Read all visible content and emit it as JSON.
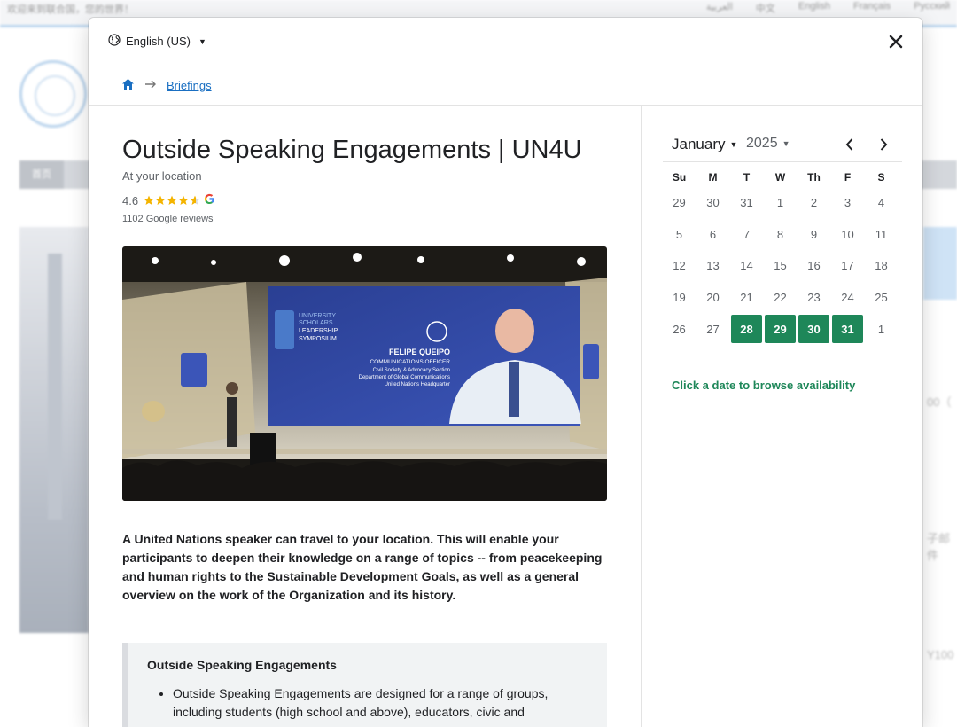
{
  "background": {
    "welcome_text": "欢迎来到联合国，您的世界！",
    "languages": [
      "العربية",
      "中文",
      "English",
      "Français",
      "Русский"
    ],
    "nav_first": "首页",
    "right_fragments": [
      "00（",
      "子邮件",
      "Y100"
    ]
  },
  "header": {
    "language_label": "English (US)",
    "breadcrumb": {
      "home_icon": "home-icon",
      "separator_icon": "arrow-right-icon",
      "current": "Briefings"
    },
    "close_icon": "close-icon"
  },
  "listing": {
    "title": "Outside Speaking Engagements | UN4U",
    "location": "At your location",
    "rating": "4.6",
    "stars": 4.6,
    "reviews": "1102 Google reviews",
    "hero": {
      "banner_line1": "UNIVERSITY",
      "banner_line2": "SCHOLARS",
      "banner_line3": "LEADERSHIP",
      "banner_line4": "SYMPOSIUM",
      "speaker_name": "FELIPE QUEIPO",
      "speaker_title": "COMMUNICATIONS OFFICER",
      "speaker_line3": "Civil Society & Advocacy Section",
      "speaker_line4": "Department of Global Communications",
      "speaker_line5": "United Nations Headquarter"
    },
    "description": "A United Nations speaker can travel to your location. This will enable your participants to deepen their knowledge on a range of topics -- from peacekeeping and human rights to the Sustainable Development Goals, as well as a general overview on the work of the Organization and its history.",
    "info_box": {
      "heading": "Outside Speaking Engagements",
      "bullet1": "Outside Speaking Engagements are designed for a range of groups, including students (high school and above), educators, civic and"
    }
  },
  "calendar": {
    "month": "January",
    "year": "2025",
    "weekdays": [
      "Su",
      "M",
      "T",
      "W",
      "Th",
      "F",
      "S"
    ],
    "weeks": [
      [
        "29",
        "30",
        "31",
        "1",
        "2",
        "3",
        "4"
      ],
      [
        "5",
        "6",
        "7",
        "8",
        "9",
        "10",
        "11"
      ],
      [
        "12",
        "13",
        "14",
        "15",
        "16",
        "17",
        "18"
      ],
      [
        "19",
        "20",
        "21",
        "22",
        "23",
        "24",
        "25"
      ],
      [
        "26",
        "27",
        "28",
        "29",
        "30",
        "31",
        "1"
      ]
    ],
    "available_color": "#1e8759",
    "hint": "Click a date to browse availability"
  },
  "colors": {
    "accent_green": "#1e8759",
    "link_blue": "#1a6fc2",
    "star_gold": "#f4b400"
  }
}
